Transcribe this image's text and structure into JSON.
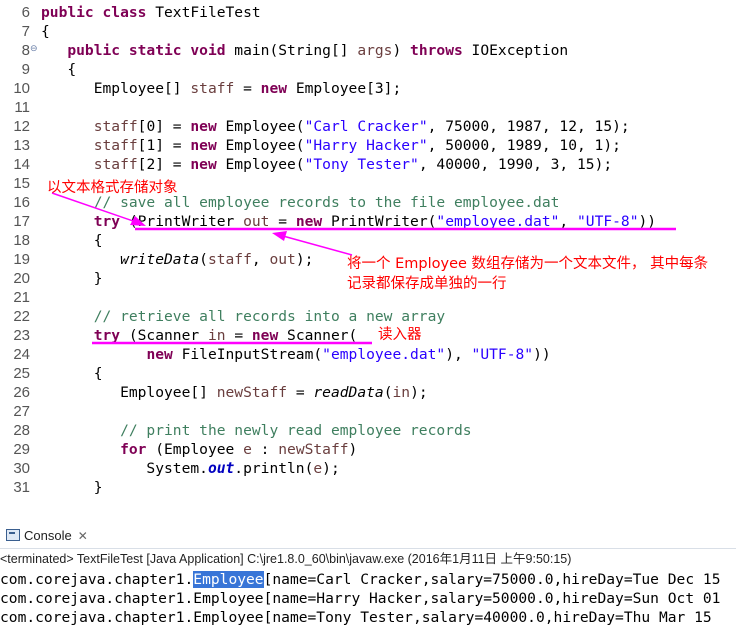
{
  "editor": {
    "lines": [
      {
        "num": "6",
        "fold": "",
        "tokens": [
          {
            "t": "public class",
            "c": "kw"
          },
          {
            "t": " TextFileTest"
          }
        ]
      },
      {
        "num": "7",
        "fold": "",
        "tokens": [
          {
            "t": "{"
          }
        ]
      },
      {
        "num": "8",
        "fold": "⊖",
        "tokens": [
          {
            "t": "   "
          },
          {
            "t": "public static void",
            "c": "kw"
          },
          {
            "t": " main(String[] "
          },
          {
            "t": "args",
            "c": "par"
          },
          {
            "t": ") "
          },
          {
            "t": "throws",
            "c": "kw"
          },
          {
            "t": " IOException"
          }
        ]
      },
      {
        "num": "9",
        "fold": "",
        "tokens": [
          {
            "t": "   {"
          }
        ]
      },
      {
        "num": "10",
        "fold": "",
        "tokens": [
          {
            "t": "      Employee[] "
          },
          {
            "t": "staff",
            "c": "var"
          },
          {
            "t": " = "
          },
          {
            "t": "new",
            "c": "kw"
          },
          {
            "t": " Employee[3];"
          }
        ]
      },
      {
        "num": "11",
        "fold": "",
        "tokens": []
      },
      {
        "num": "12",
        "fold": "",
        "tokens": [
          {
            "t": "      "
          },
          {
            "t": "staff",
            "c": "var"
          },
          {
            "t": "[0] = "
          },
          {
            "t": "new",
            "c": "kw"
          },
          {
            "t": " Employee("
          },
          {
            "t": "\"Carl Cracker\"",
            "c": "str"
          },
          {
            "t": ", 75000, 1987, 12, 15);"
          }
        ]
      },
      {
        "num": "13",
        "fold": "",
        "tokens": [
          {
            "t": "      "
          },
          {
            "t": "staff",
            "c": "var"
          },
          {
            "t": "[1] = "
          },
          {
            "t": "new",
            "c": "kw"
          },
          {
            "t": " Employee("
          },
          {
            "t": "\"Harry Hacker\"",
            "c": "str"
          },
          {
            "t": ", 50000, 1989, 10, 1);"
          }
        ]
      },
      {
        "num": "14",
        "fold": "",
        "tokens": [
          {
            "t": "      "
          },
          {
            "t": "staff",
            "c": "var"
          },
          {
            "t": "[2] = "
          },
          {
            "t": "new",
            "c": "kw"
          },
          {
            "t": " Employee("
          },
          {
            "t": "\"Tony Tester\"",
            "c": "str"
          },
          {
            "t": ", 40000, 1990, 3, 15);"
          }
        ]
      },
      {
        "num": "15",
        "fold": "",
        "tokens": []
      },
      {
        "num": "16",
        "fold": "",
        "tokens": [
          {
            "t": "      "
          },
          {
            "t": "// save all employee records to the file employee.dat",
            "c": "cmt"
          }
        ]
      },
      {
        "num": "17",
        "fold": "",
        "tokens": [
          {
            "t": "      "
          },
          {
            "t": "try",
            "c": "kw"
          },
          {
            "t": " (PrintWriter "
          },
          {
            "t": "out",
            "c": "var"
          },
          {
            "t": " = "
          },
          {
            "t": "new",
            "c": "kw"
          },
          {
            "t": " PrintWriter("
          },
          {
            "t": "\"employee.dat\"",
            "c": "str"
          },
          {
            "t": ", "
          },
          {
            "t": "\"UTF-8\"",
            "c": "str"
          },
          {
            "t": "))"
          }
        ]
      },
      {
        "num": "18",
        "fold": "",
        "tokens": [
          {
            "t": "      {"
          }
        ]
      },
      {
        "num": "19",
        "fold": "",
        "tokens": [
          {
            "t": "         "
          },
          {
            "t": "writeData",
            "c": "mth"
          },
          {
            "t": "("
          },
          {
            "t": "staff",
            "c": "var"
          },
          {
            "t": ", "
          },
          {
            "t": "out",
            "c": "var"
          },
          {
            "t": ");"
          }
        ]
      },
      {
        "num": "20",
        "fold": "",
        "tokens": [
          {
            "t": "      }"
          }
        ]
      },
      {
        "num": "21",
        "fold": "",
        "tokens": []
      },
      {
        "num": "22",
        "fold": "",
        "tokens": [
          {
            "t": "      "
          },
          {
            "t": "// retrieve all records into a new array",
            "c": "cmt"
          }
        ]
      },
      {
        "num": "23",
        "fold": "",
        "tokens": [
          {
            "t": "      "
          },
          {
            "t": "try",
            "c": "kw"
          },
          {
            "t": " (Scanner "
          },
          {
            "t": "in",
            "c": "var"
          },
          {
            "t": " = "
          },
          {
            "t": "new",
            "c": "kw"
          },
          {
            "t": " Scanner("
          }
        ]
      },
      {
        "num": "24",
        "fold": "",
        "tokens": [
          {
            "t": "            "
          },
          {
            "t": "new",
            "c": "kw"
          },
          {
            "t": " FileInputStream("
          },
          {
            "t": "\"employee.dat\"",
            "c": "str"
          },
          {
            "t": "), "
          },
          {
            "t": "\"UTF-8\"",
            "c": "str"
          },
          {
            "t": "))"
          }
        ]
      },
      {
        "num": "25",
        "fold": "",
        "tokens": [
          {
            "t": "      {"
          }
        ]
      },
      {
        "num": "26",
        "fold": "",
        "tokens": [
          {
            "t": "         Employee[] "
          },
          {
            "t": "newStaff",
            "c": "var"
          },
          {
            "t": " = "
          },
          {
            "t": "readData",
            "c": "mth"
          },
          {
            "t": "("
          },
          {
            "t": "in",
            "c": "var"
          },
          {
            "t": ");"
          }
        ]
      },
      {
        "num": "27",
        "fold": "",
        "tokens": []
      },
      {
        "num": "28",
        "fold": "",
        "tokens": [
          {
            "t": "         "
          },
          {
            "t": "// print the newly read employee records",
            "c": "cmt"
          }
        ]
      },
      {
        "num": "29",
        "fold": "",
        "tokens": [
          {
            "t": "         "
          },
          {
            "t": "for",
            "c": "kw"
          },
          {
            "t": " (Employee "
          },
          {
            "t": "e",
            "c": "var"
          },
          {
            "t": " : "
          },
          {
            "t": "newStaff",
            "c": "var"
          },
          {
            "t": ")"
          }
        ]
      },
      {
        "num": "30",
        "fold": "",
        "tokens": [
          {
            "t": "            System."
          },
          {
            "t": "out",
            "c": "fld"
          },
          {
            "t": ".println("
          },
          {
            "t": "e",
            "c": "var"
          },
          {
            "t": ");"
          }
        ]
      },
      {
        "num": "31",
        "fold": "",
        "tokens": [
          {
            "t": "      }"
          }
        ]
      }
    ]
  },
  "annotations": {
    "note_store": "以文本格式存储对象",
    "note_array_line1": "将一个 Employee 数组存储为一个文本文件， 其中每条",
    "note_array_line2": "记录都保存成单独的一行",
    "note_reader": "读入器",
    "color": "#ff0000",
    "underline_color": "#ff00ff"
  },
  "console": {
    "tab_label": "Console",
    "close_glyph": "✕",
    "status": "<terminated> TextFileTest [Java Application] C:\\jre1.8.0_60\\bin\\javaw.exe (2016年1月11日 上午9:50:15)",
    "output": [
      {
        "before": "com.corejava.chapter1.",
        "highlight": "Employee",
        "after": "[name=Carl Cracker,salary=75000.0,hireDay=Tue Dec 15"
      },
      {
        "before": "com.corejava.chapter1.Employee[name=Harry Hacker,salary=50000.0,hireDay=Sun Oct 01",
        "highlight": "",
        "after": ""
      },
      {
        "before": "com.corejava.chapter1.Employee[name=Tony Tester,salary=40000.0,hireDay=Thu Mar 15",
        "highlight": "",
        "after": ""
      }
    ],
    "selection_color": "#3875d7"
  }
}
